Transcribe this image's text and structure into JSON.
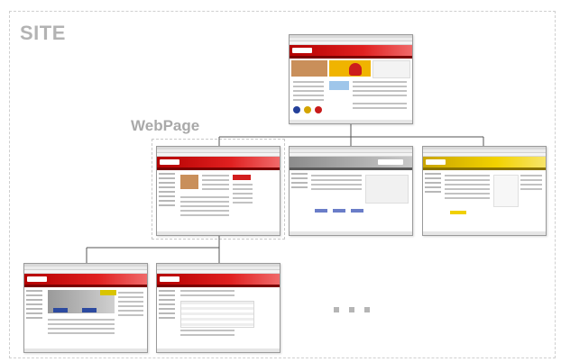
{
  "labels": {
    "site": "SITE",
    "webpage": "WebPage"
  },
  "continuation_marker": "more-pages"
}
